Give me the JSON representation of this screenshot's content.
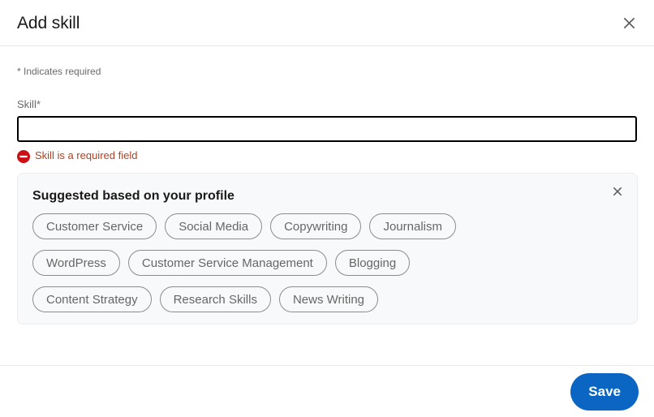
{
  "header": {
    "title": "Add skill",
    "close_icon": "close-icon"
  },
  "body": {
    "required_note": "* Indicates required",
    "field": {
      "label": "Skill*",
      "value": "",
      "placeholder": ""
    },
    "error": {
      "icon": "error-circle-icon",
      "message": "Skill is a required field",
      "color": "#b24020"
    },
    "suggestions": {
      "title": "Suggested based on your profile",
      "dismiss_icon": "close-icon",
      "rows": [
        [
          "Customer Service",
          "Social Media",
          "Copywriting",
          "Journalism"
        ],
        [
          "WordPress",
          "Customer Service Management",
          "Blogging"
        ],
        [
          "Content Strategy",
          "Research Skills",
          "News Writing"
        ]
      ]
    }
  },
  "footer": {
    "save_label": "Save",
    "accent_color": "#0a66c2"
  }
}
